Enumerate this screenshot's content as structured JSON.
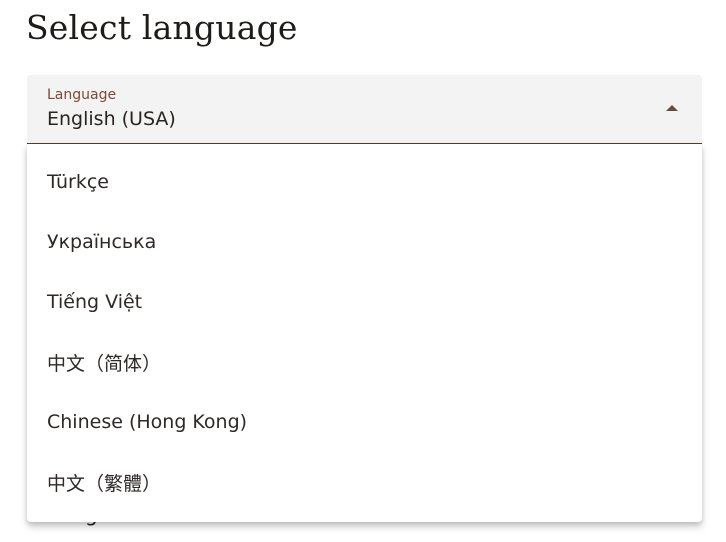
{
  "page": {
    "title": "Select language"
  },
  "language_select": {
    "label": "Language",
    "value": "English (USA)",
    "expanded": true,
    "options": [
      "Türkçe",
      "Українська",
      "Tiếng Việt",
      "中文（简体）",
      "Chinese (Hong Kong)",
      "中文（繁體）"
    ]
  },
  "partially_hidden": {
    "text": "g"
  }
}
